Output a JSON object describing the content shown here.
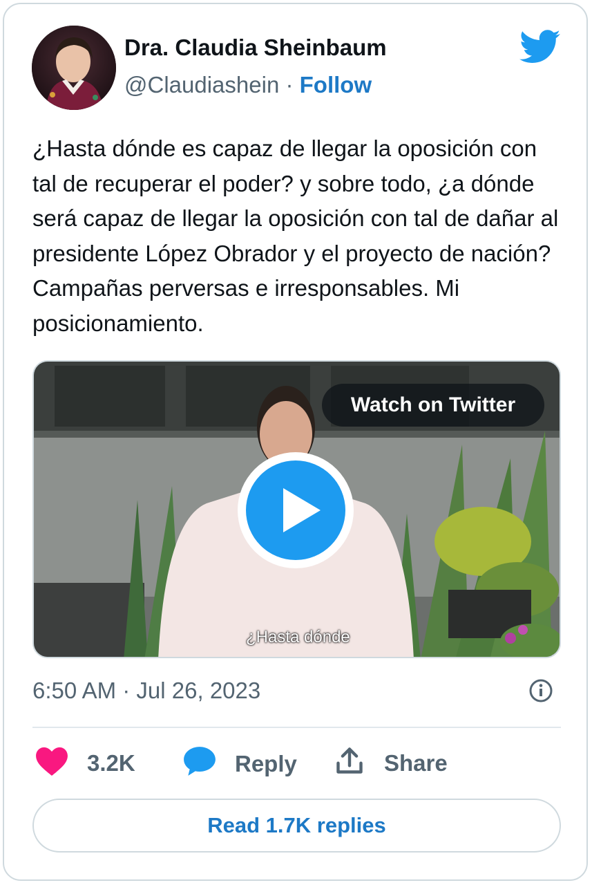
{
  "author": {
    "name": "Dra. Claudia Sheinbaum",
    "handle": "@Claudiashein",
    "separator": "·",
    "follow_label": "Follow"
  },
  "tweet": {
    "text": "¿Hasta dónde es capaz de llegar la oposición con tal de recuperar el poder? y sobre todo, ¿a dónde será capaz de llegar la oposición con tal de dañar al presidente López Obrador y el proyecto de nación? Campañas perversas e irresponsables. Mi posicionamiento."
  },
  "media": {
    "watch_label": "Watch on Twitter",
    "caption": "¿Hasta dónde"
  },
  "meta": {
    "time": "6:50 AM",
    "separator": "·",
    "date": "Jul 26, 2023"
  },
  "actions": {
    "likes": "3.2K",
    "reply_label": "Reply",
    "share_label": "Share"
  },
  "read_replies_label": "Read 1.7K replies",
  "icons": {
    "brand": "twitter-bird-icon",
    "like": "heart-icon",
    "reply": "speech-bubble-icon",
    "share": "share-upload-icon",
    "info": "info-icon",
    "play": "play-icon"
  },
  "colors": {
    "twitter_blue": "#1d9bf0",
    "link_blue": "#1d79c6",
    "like_pink": "#f91880",
    "text": "#0f1419",
    "secondary": "#536471",
    "border": "#cfd9de"
  }
}
